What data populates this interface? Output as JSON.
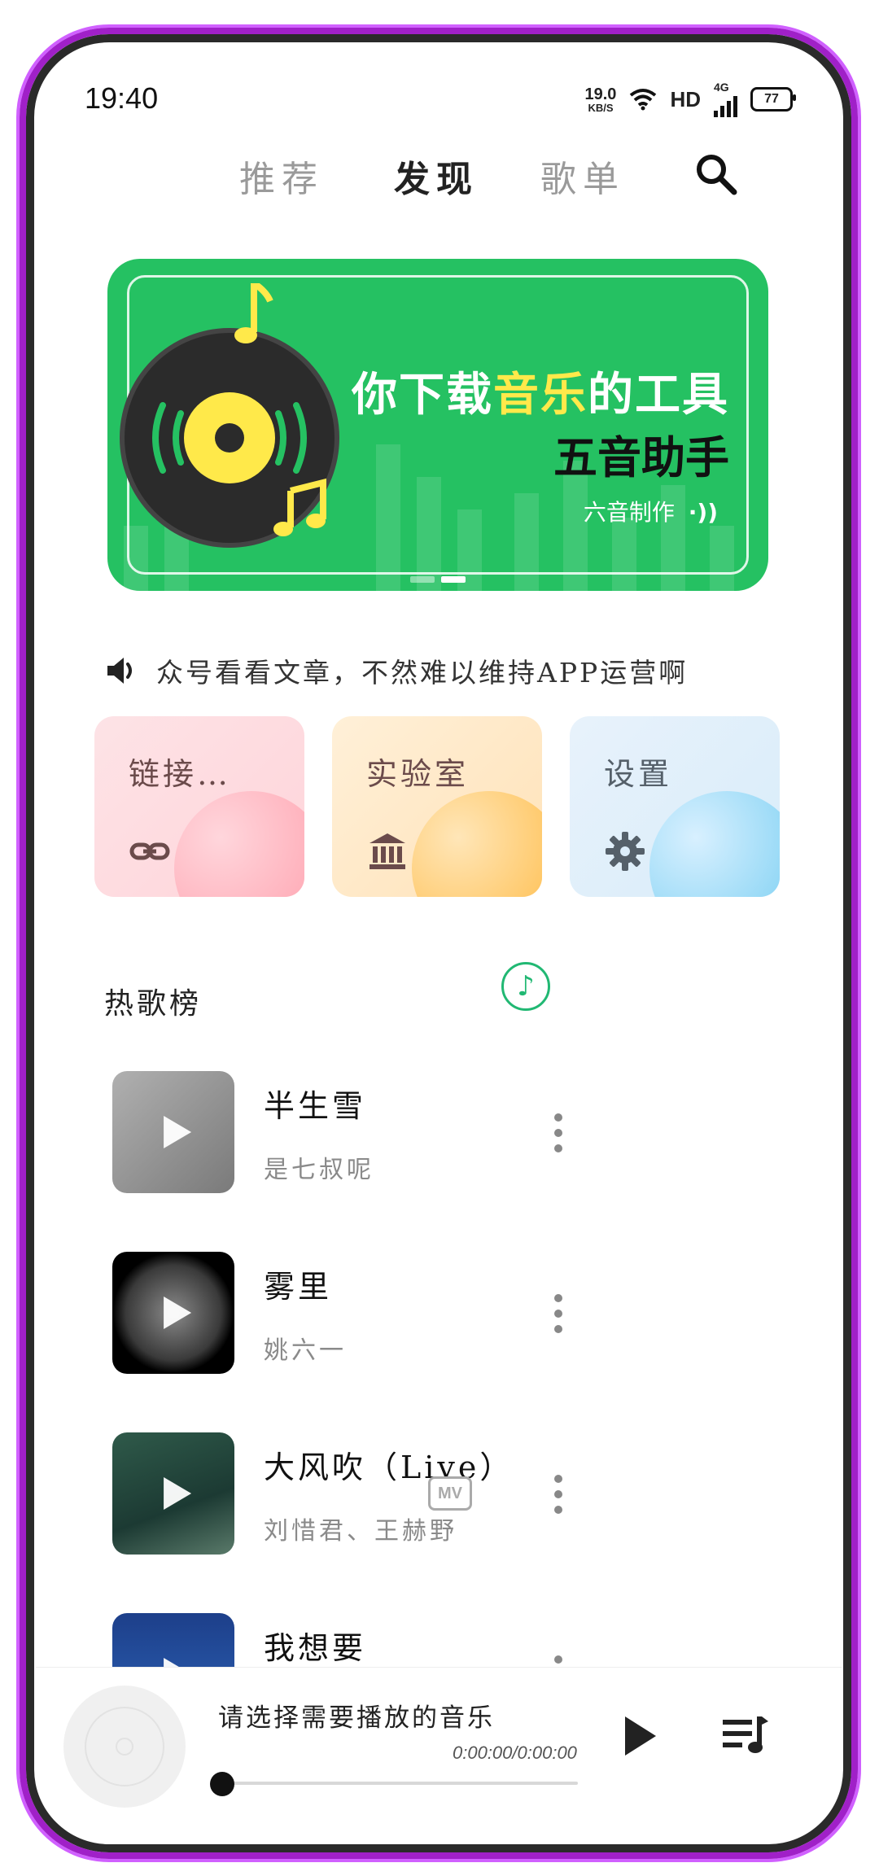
{
  "status_bar": {
    "time": "19:40",
    "net_speed_value": "19.0",
    "net_speed_unit": "KB/S",
    "hd_label": "HD",
    "network_label": "4G",
    "battery": "77"
  },
  "top_tabs": [
    {
      "label": "推荐",
      "active": false
    },
    {
      "label": "发现",
      "active": true
    },
    {
      "label": "歌单",
      "active": false
    }
  ],
  "banner": {
    "line1_before": "你下载",
    "line1_highlight": "音乐",
    "line1_after": "的工具",
    "line2": "五音助手",
    "line3": "六音制作",
    "pages": 2,
    "active_page": 2,
    "colors": {
      "background": "#25c162",
      "highlight": "#ffe94a"
    }
  },
  "notice": {
    "text": "众号看看文章，不然难以维持APP运营啊"
  },
  "quick_cards": [
    {
      "label": "链接…",
      "icon": "link-icon"
    },
    {
      "label": "实验室",
      "icon": "bank-icon"
    },
    {
      "label": "设置",
      "icon": "gear-icon"
    }
  ],
  "hot_section": {
    "title": "热歌榜",
    "action_icon": "music-note-icon"
  },
  "songs": [
    {
      "title": "半生雪",
      "artist": "是七叔呢",
      "mv": false
    },
    {
      "title": "雾里",
      "artist": "姚六一",
      "mv": false
    },
    {
      "title": "大风吹（Live）",
      "artist": "刘惜君、王赫野",
      "mv": true,
      "mv_label": "MV"
    },
    {
      "title": "我想要",
      "artist": "",
      "mv": false
    }
  ],
  "player": {
    "title": "请选择需要播放的音乐",
    "time": "0:00:00/0:00:00",
    "progress": 0
  },
  "accent_color": "#21b873"
}
